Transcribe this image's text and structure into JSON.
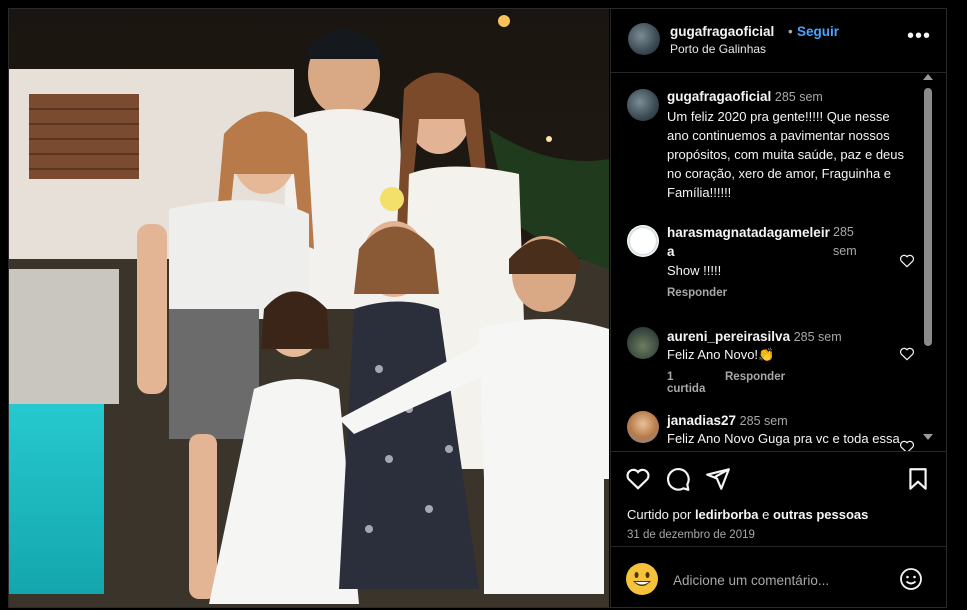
{
  "post": {
    "username": "gugafragaoficial",
    "dot": "•",
    "follow_label": "Seguir",
    "location": "Porto de Galinhas",
    "more_label": "•••"
  },
  "caption": {
    "username": "gugafragaoficial",
    "time": "285 sem",
    "text": "Um feliz 2020 pra gente!!!!! Que nesse ano continuemos a pavimentar nossos propósitos, com muita saúde, paz e deus no coração, xero de amor, Fraguinha e Família!!!!!!"
  },
  "comments": [
    {
      "username": "harasmagnatadagameleira",
      "time": "285 sem",
      "text": "Show !!!!!",
      "likes": "",
      "reply": "Responder"
    },
    {
      "username": "aureni_pereirasilva",
      "time": "285 sem",
      "text": "Feliz Ano Novo!👏",
      "likes": "1 curtida",
      "reply": "Responder"
    },
    {
      "username": "janadias27",
      "time": "285 sem",
      "text": "Feliz Ano Novo Guga pra vc e toda essa família linda",
      "likes": "",
      "reply": ""
    }
  ],
  "likes": {
    "prefix": "Curtido por",
    "user": "ledirborba",
    "mid": "e",
    "others": "outras pessoas"
  },
  "date": "31 de dezembro de 2019",
  "add_comment": {
    "placeholder": "Adicione um comentário..."
  },
  "icons": [
    "heart-icon",
    "comment-icon",
    "share-icon",
    "bookmark-icon",
    "emoji-icon",
    "more-icon"
  ],
  "colors": {
    "accent": "#4aa3ff",
    "background": "#000000",
    "muted": "#a8a8a8"
  }
}
